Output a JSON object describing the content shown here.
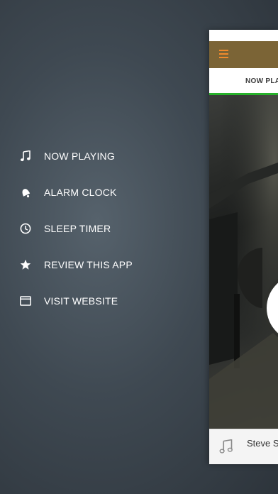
{
  "menu": {
    "items": [
      {
        "label": "NOW PLAYING",
        "icon": "music-note-icon"
      },
      {
        "label": "ALARM CLOCK",
        "icon": "alarm-bell-icon"
      },
      {
        "label": "SLEEP TIMER",
        "icon": "clock-icon"
      },
      {
        "label": "REVIEW THIS APP",
        "icon": "star-icon"
      },
      {
        "label": "VISIT WEBSITE",
        "icon": "browser-window-icon"
      }
    ]
  },
  "app": {
    "tab": {
      "label": "NOW PLAYING"
    },
    "player": {
      "title": "Steve S",
      "icon": "music-note-icon"
    }
  },
  "colors": {
    "toolbar": "#7b6436",
    "accent": "#f08a2c",
    "tab_indicator": "#27b12a"
  }
}
